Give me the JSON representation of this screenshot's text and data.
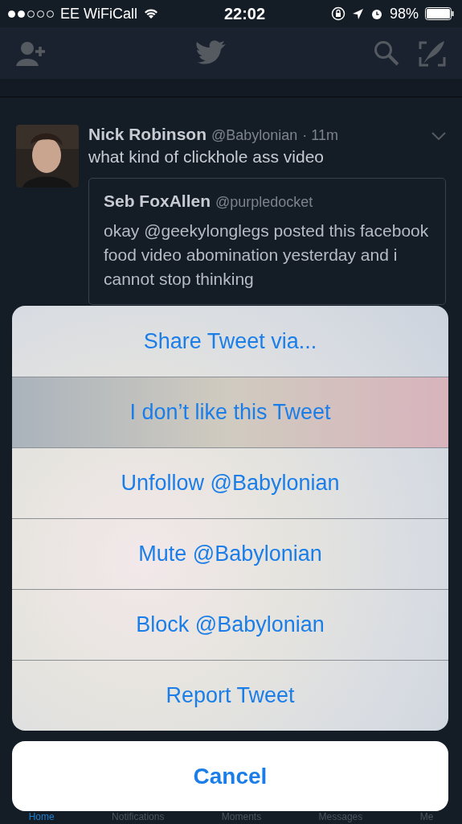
{
  "status_bar": {
    "carrier": "EE WiFiCall",
    "time": "22:02",
    "battery": "98%"
  },
  "tweet": {
    "name": "Nick Robinson",
    "handle": "@Babylonian",
    "time": "· 11m",
    "text": "what kind of clickhole ass video",
    "quote": {
      "name": "Seb FoxAllen",
      "handle": "@purpledocket",
      "text": "okay @geekylonglegs posted this facebook food video abomination yesterday and i cannot stop thinking"
    }
  },
  "action_sheet": {
    "items": [
      {
        "label": "Share Tweet via...",
        "selected": false
      },
      {
        "label": "I don’t like this Tweet",
        "selected": true
      },
      {
        "label": "Unfollow @Babylonian",
        "selected": false
      },
      {
        "label": "Mute @Babylonian",
        "selected": false
      },
      {
        "label": "Block @Babylonian",
        "selected": false
      },
      {
        "label": "Report Tweet",
        "selected": false
      }
    ],
    "cancel": "Cancel"
  },
  "tab_bar": [
    {
      "label": "Home",
      "selected": true
    },
    {
      "label": "Notifications",
      "selected": false
    },
    {
      "label": "Moments",
      "selected": false
    },
    {
      "label": "Messages",
      "selected": false
    },
    {
      "label": "Me",
      "selected": false
    }
  ]
}
